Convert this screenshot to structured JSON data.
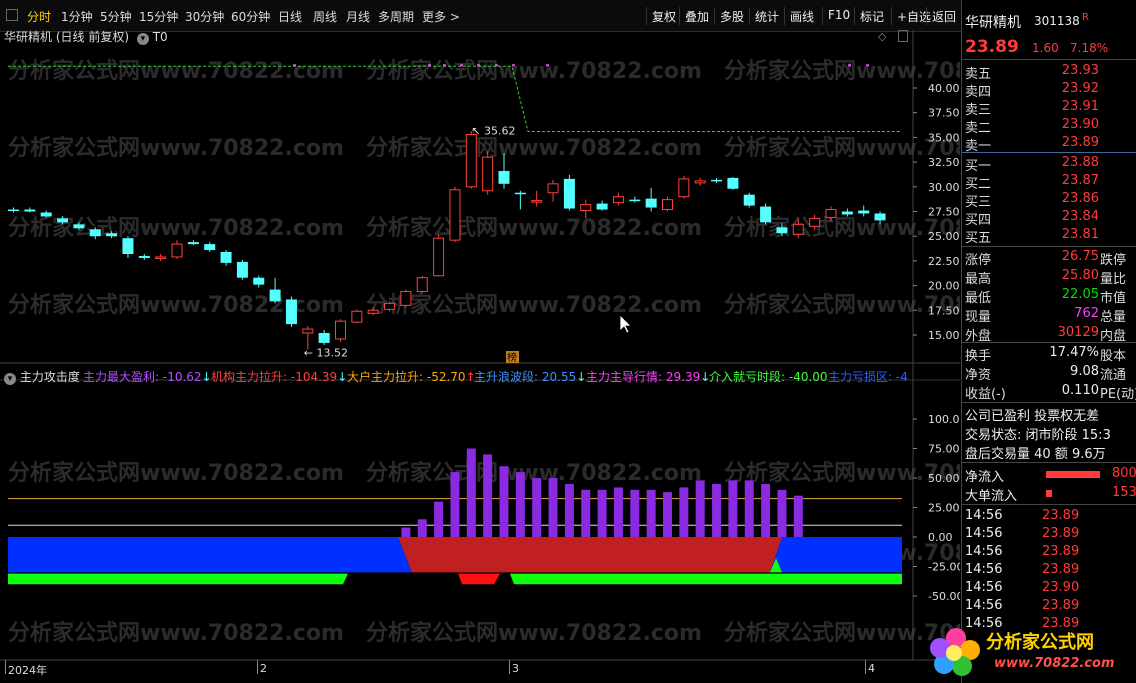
{
  "toolbar": {
    "periods": [
      "分时",
      "1分钟",
      "5分钟",
      "15分钟",
      "30分钟",
      "60分钟",
      "日线",
      "周线",
      "月线",
      "多周期",
      "更多 >"
    ],
    "active": "分时",
    "buttons": [
      "复权",
      "叠加",
      "多股",
      "统计",
      "画线",
      "F10",
      "标记",
      "+自选",
      "返回"
    ]
  },
  "chart_title": {
    "name": "华研精机",
    "mode": "(日线 前复权)",
    "t0": "T0"
  },
  "price_axis": [
    "40.00",
    "37.50",
    "35.00",
    "32.50",
    "30.00",
    "27.50",
    "25.00",
    "22.50",
    "20.00",
    "17.50",
    "15.00"
  ],
  "annotations": {
    "high": "35.62",
    "low": "13.52",
    "bang": "榜"
  },
  "indicator": {
    "name": "主力攻击度",
    "items": [
      {
        "label": "主力最大盈利: -10.62",
        "arrow": "↓",
        "color": "#b050ff"
      },
      {
        "label": "机构主力拉升: -104.39",
        "arrow": "↓",
        "color": "#ff4040"
      },
      {
        "label": "大户主力拉升: -52.70",
        "arrow": "↑",
        "color": "#ffa500"
      },
      {
        "label": "主升浪波段: 20.55",
        "arrow": "↓",
        "color": "#4090ff"
      },
      {
        "label": "主力主导行情: 29.39",
        "arrow": "↓",
        "color": "#ff40ff"
      },
      {
        "label": "介入就亏时段: -40.00",
        "arrow": "",
        "color": "#40ff40"
      },
      {
        "label": "主力亏损区: -4",
        "arrow": "",
        "color": "#3060ff"
      }
    ],
    "axis": [
      "100.00",
      "75.00",
      "50.00",
      "25.00",
      "0.00",
      "-25.00",
      "-50.00"
    ]
  },
  "dates": [
    "2024年",
    "2",
    "3",
    "4"
  ],
  "watermark": "分析家公式网www.70822.com",
  "logo": {
    "name": "分析家公式网",
    "url": "www.70822.com"
  },
  "chart_data": {
    "type": "candlestick",
    "ylim": [
      12.5,
      42.5
    ],
    "candles": [
      {
        "o": 27.7,
        "h": 27.9,
        "l": 27.4,
        "c": 27.6,
        "up": false
      },
      {
        "o": 27.7,
        "h": 27.9,
        "l": 27.4,
        "c": 27.5,
        "up": false
      },
      {
        "o": 27.4,
        "h": 27.6,
        "l": 26.9,
        "c": 27.0,
        "up": false
      },
      {
        "o": 26.8,
        "h": 27.0,
        "l": 26.2,
        "c": 26.4,
        "up": false
      },
      {
        "o": 26.2,
        "h": 26.4,
        "l": 25.6,
        "c": 25.8,
        "up": false
      },
      {
        "o": 25.7,
        "h": 25.9,
        "l": 24.7,
        "c": 25.0,
        "up": false
      },
      {
        "o": 25.3,
        "h": 25.5,
        "l": 24.8,
        "c": 25.0,
        "up": false
      },
      {
        "o": 24.8,
        "h": 25.0,
        "l": 22.8,
        "c": 23.2,
        "up": false
      },
      {
        "o": 23.0,
        "h": 23.2,
        "l": 22.6,
        "c": 22.8,
        "up": false
      },
      {
        "o": 22.8,
        "h": 23.2,
        "l": 22.5,
        "c": 22.9,
        "up": true
      },
      {
        "o": 22.9,
        "h": 24.6,
        "l": 22.7,
        "c": 24.2,
        "up": true
      },
      {
        "o": 24.4,
        "h": 24.6,
        "l": 24.1,
        "c": 24.2,
        "up": false
      },
      {
        "o": 24.2,
        "h": 24.4,
        "l": 23.4,
        "c": 23.6,
        "up": false
      },
      {
        "o": 23.4,
        "h": 23.6,
        "l": 22.0,
        "c": 22.3,
        "up": false
      },
      {
        "o": 22.4,
        "h": 22.6,
        "l": 20.6,
        "c": 20.8,
        "up": false
      },
      {
        "o": 20.8,
        "h": 21.0,
        "l": 19.8,
        "c": 20.1,
        "up": false
      },
      {
        "o": 19.6,
        "h": 20.8,
        "l": 18.2,
        "c": 18.4,
        "up": false
      },
      {
        "o": 18.6,
        "h": 18.9,
        "l": 15.8,
        "c": 16.1,
        "up": false
      },
      {
        "o": 15.6,
        "h": 15.9,
        "l": 13.52,
        "c": 15.2,
        "up": true
      },
      {
        "o": 15.2,
        "h": 15.5,
        "l": 14.0,
        "c": 14.2,
        "up": false
      },
      {
        "o": 14.6,
        "h": 16.6,
        "l": 14.3,
        "c": 16.4,
        "up": true
      },
      {
        "o": 16.3,
        "h": 17.6,
        "l": 16.2,
        "c": 17.4,
        "up": true
      },
      {
        "o": 17.2,
        "h": 17.8,
        "l": 17.0,
        "c": 17.5,
        "up": true
      },
      {
        "o": 17.6,
        "h": 18.4,
        "l": 17.4,
        "c": 18.2,
        "up": true
      },
      {
        "o": 18.0,
        "h": 19.6,
        "l": 17.8,
        "c": 19.4,
        "up": true
      },
      {
        "o": 19.4,
        "h": 21.0,
        "l": 19.2,
        "c": 20.8,
        "up": true
      },
      {
        "o": 21.0,
        "h": 25.2,
        "l": 20.9,
        "c": 24.8,
        "up": true
      },
      {
        "o": 24.6,
        "h": 30.0,
        "l": 24.4,
        "c": 29.7,
        "up": true
      },
      {
        "o": 30.0,
        "h": 35.62,
        "l": 29.8,
        "c": 35.3,
        "up": true
      },
      {
        "o": 33.0,
        "h": 33.6,
        "l": 29.2,
        "c": 29.6,
        "up": true
      },
      {
        "o": 31.6,
        "h": 33.4,
        "l": 29.8,
        "c": 30.3,
        "up": false
      },
      {
        "o": 29.4,
        "h": 29.6,
        "l": 27.7,
        "c": 29.3,
        "up": false
      },
      {
        "o": 28.6,
        "h": 29.6,
        "l": 28.0,
        "c": 28.5,
        "up": true
      },
      {
        "o": 29.4,
        "h": 30.7,
        "l": 28.5,
        "c": 30.3,
        "up": true
      },
      {
        "o": 30.8,
        "h": 31.2,
        "l": 27.6,
        "c": 27.8,
        "up": false
      },
      {
        "o": 27.6,
        "h": 28.7,
        "l": 26.8,
        "c": 28.2,
        "up": true
      },
      {
        "o": 28.3,
        "h": 28.6,
        "l": 27.6,
        "c": 27.7,
        "up": false
      },
      {
        "o": 28.4,
        "h": 29.4,
        "l": 28.1,
        "c": 29.0,
        "up": true
      },
      {
        "o": 28.7,
        "h": 29.0,
        "l": 28.4,
        "c": 28.6,
        "up": false
      },
      {
        "o": 28.8,
        "h": 29.9,
        "l": 27.5,
        "c": 27.9,
        "up": false
      },
      {
        "o": 27.7,
        "h": 29.0,
        "l": 27.5,
        "c": 28.7,
        "up": true
      },
      {
        "o": 29.0,
        "h": 31.1,
        "l": 28.8,
        "c": 30.8,
        "up": true
      },
      {
        "o": 30.4,
        "h": 30.9,
        "l": 30.1,
        "c": 30.6,
        "up": true
      },
      {
        "o": 30.7,
        "h": 30.9,
        "l": 30.4,
        "c": 30.6,
        "up": false
      },
      {
        "o": 30.9,
        "h": 31.0,
        "l": 29.7,
        "c": 29.8,
        "up": false
      },
      {
        "o": 29.2,
        "h": 29.4,
        "l": 27.9,
        "c": 28.1,
        "up": false
      },
      {
        "o": 28.0,
        "h": 28.3,
        "l": 26.2,
        "c": 26.4,
        "up": false
      },
      {
        "o": 25.9,
        "h": 26.3,
        "l": 25.0,
        "c": 25.3,
        "up": false
      },
      {
        "o": 25.2,
        "h": 26.8,
        "l": 24.8,
        "c": 26.2,
        "up": true
      },
      {
        "o": 26.0,
        "h": 27.2,
        "l": 25.6,
        "c": 26.8,
        "up": true
      },
      {
        "o": 26.9,
        "h": 28.0,
        "l": 26.5,
        "c": 27.7,
        "up": true
      },
      {
        "o": 27.5,
        "h": 27.8,
        "l": 27.0,
        "c": 27.2,
        "up": false
      },
      {
        "o": 27.6,
        "h": 28.1,
        "l": 27.0,
        "c": 27.3,
        "up": false
      },
      {
        "o": 27.3,
        "h": 27.5,
        "l": 26.2,
        "c": 26.6,
        "up": false
      }
    ],
    "stop_line": {
      "before": 42.2,
      "after": 35.6
    },
    "bars": [
      0,
      0,
      0,
      0,
      0,
      0,
      0,
      0,
      0,
      0,
      0,
      0,
      0,
      0,
      0,
      0,
      0,
      0,
      0,
      0,
      0,
      0,
      0,
      0,
      8,
      15,
      30,
      55,
      75,
      70,
      60,
      55,
      50,
      50,
      45,
      40,
      40,
      42,
      40,
      40,
      38,
      42,
      48,
      45,
      48,
      48,
      45,
      40,
      35,
      0,
      0,
      0,
      0,
      0
    ],
    "ref_lines": [
      30,
      10
    ]
  },
  "quote": {
    "name": "华研精机",
    "code": "301138",
    "flag": "R",
    "price": "23.89",
    "change": "1.60",
    "pct": "7.18%",
    "asks": [
      {
        "k": "卖五",
        "v": "23.93"
      },
      {
        "k": "卖四",
        "v": "23.92"
      },
      {
        "k": "卖三",
        "v": "23.91"
      },
      {
        "k": "卖二",
        "v": "23.90"
      },
      {
        "k": "卖一",
        "v": "23.89"
      }
    ],
    "bids": [
      {
        "k": "买一",
        "v": "23.88"
      },
      {
        "k": "买二",
        "v": "23.87"
      },
      {
        "k": "买三",
        "v": "23.86"
      },
      {
        "k": "买四",
        "v": "23.84"
      },
      {
        "k": "买五",
        "v": "23.81"
      }
    ],
    "stats": [
      {
        "k": "涨停",
        "v": "26.75",
        "c": "red",
        "k2": "跌停"
      },
      {
        "k": "最高",
        "v": "25.80",
        "c": "red",
        "k2": "量比"
      },
      {
        "k": "最低",
        "v": "22.05",
        "c": "green",
        "k2": "市值"
      },
      {
        "k": "现量",
        "v": "762",
        "c": "mag",
        "k2": "总量"
      },
      {
        "k": "外盘",
        "v": "30129",
        "c": "red",
        "k2": "内盘"
      }
    ],
    "stats2": [
      {
        "k": "换手",
        "v": "17.47%",
        "k2": "股本"
      },
      {
        "k": "净资",
        "v": "9.08",
        "k2": "流通"
      },
      {
        "k": "收益(-)",
        "v": "0.110",
        "k2": "PE(动)"
      }
    ],
    "notes": [
      "公司已盈利 投票权无差",
      "交易状态: 闭市阶段 15:3",
      "盘后交易量 40 额 9.6万"
    ],
    "flows": [
      {
        "k": "净流入",
        "v": "800",
        "fill": 0.85
      },
      {
        "k": "大单流入",
        "v": "153",
        "fill": 0.1
      }
    ],
    "ticks": [
      {
        "t": "14:56",
        "p": "23.89"
      },
      {
        "t": "14:56",
        "p": "23.89"
      },
      {
        "t": "14:56",
        "p": "23.89"
      },
      {
        "t": "14:56",
        "p": "23.89"
      },
      {
        "t": "14:56",
        "p": "23.90"
      },
      {
        "t": "14:56",
        "p": "23.89"
      },
      {
        "t": "14:56",
        "p": "23.89"
      }
    ]
  }
}
